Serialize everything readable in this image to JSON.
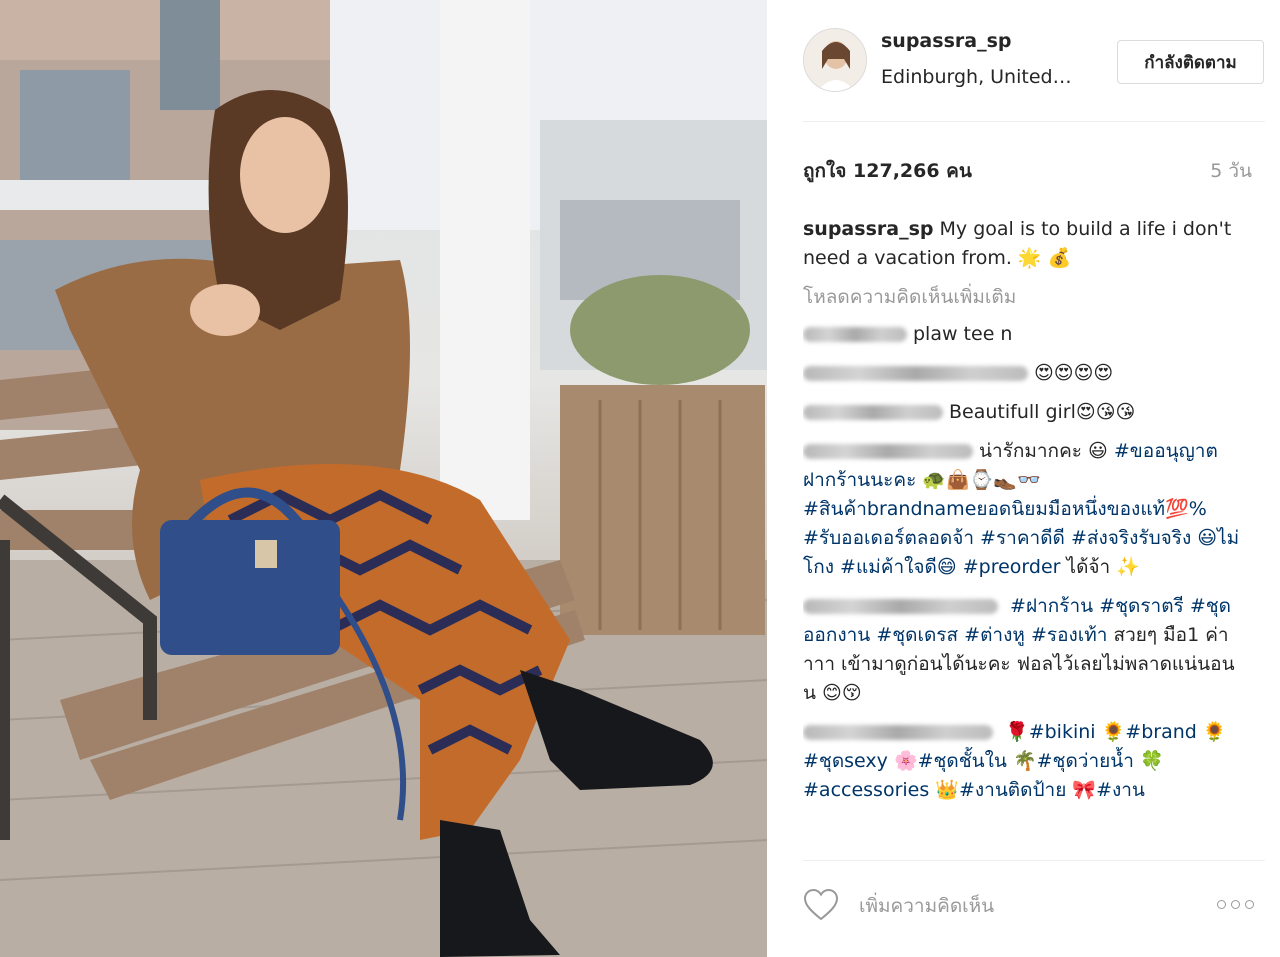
{
  "post": {
    "username": "supassra_sp",
    "location": "Edinburgh, United…",
    "follow_label": "กำลังติดตาม",
    "likes": "ถูกใจ 127,266 คน",
    "time": "5 วัน",
    "caption_text": "My goal is to build a life i don't need a vacation from. 🌟 💰",
    "load_more": "โหลดความคิดเห็นเพิ่มเติม",
    "comment_placeholder": "เพิ่มความคิดเห็น"
  },
  "comments": [
    {
      "text": "plaw tee n"
    },
    {
      "text": "😍😍😍😍"
    },
    {
      "text": "Beautifull girl😍😘😘"
    },
    {
      "text": "น่ารักมากคะ 😃",
      "tags": [
        "#ขออนุญาตฝากร้านนะคะ 🐢👜⌚👞👓",
        "#สินค้าbrandnameยอดนิยมมือหนึ่งของแท้💯%",
        "#รับออเดอร์ตลอดจ้า",
        "#ราคาดีดี",
        "#ส่งจริงรับจริง 😃ไม่โกง",
        "#แม่ค้าใจดี😄",
        "#preorder"
      ],
      "tail": "ได้จ้า ✨"
    },
    {
      "tags": [
        "#ฝากร้าน",
        "#ชุดราตรี",
        "#ชุดออกงาน",
        "#ชุดเดรส",
        "#ต่างหู",
        "#รองเท้า"
      ],
      "tail": "สวยๆ มือ1 ค่าาาา เข้ามาดูก่อนได้นะคะ ฟอลไว้เลยไม่พลาดแน่นอนน 😊😚"
    },
    {
      "tags": [
        "🌹#bikini",
        "🌻#brand",
        "🌻#ชุดsexy",
        "🌸#ชุดชั้นใน",
        "🌴#ชุดว่ายน้ำ",
        "🍀#accessories",
        "👑#งานติดป้าย",
        "🎀#งาน"
      ]
    }
  ],
  "colors": {
    "hashtag": "#003569",
    "muted": "#999999",
    "text": "#262626"
  },
  "icons": {
    "like": "heart-icon",
    "more": "ellipsis-icon"
  }
}
